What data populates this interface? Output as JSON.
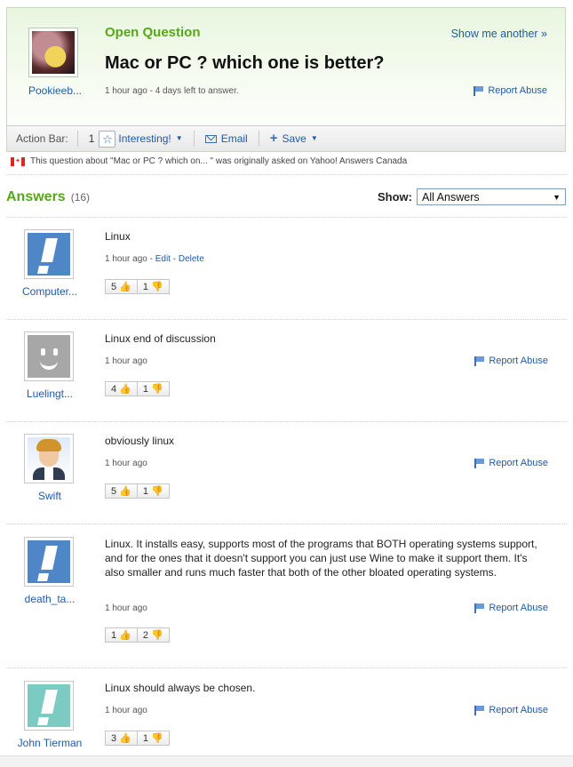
{
  "question": {
    "asker_name": "Pookieeb...",
    "status": "Open Question",
    "title": "Mac or PC ? which one is better?",
    "meta": "1 hour ago - 4 days left to answer.",
    "show_another": "Show me another »",
    "report_abuse": "Report Abuse"
  },
  "action_bar": {
    "label": "Action Bar:",
    "interesting_count": "1",
    "interesting_label": "Interesting!",
    "email_label": "Email",
    "save_label": "Save"
  },
  "origin_note": {
    "text": "This question about \"Mac or PC ? which on... \" was originally asked on Yahoo! Answers Canada"
  },
  "answers_header": {
    "title": "Answers",
    "count": "(16)",
    "show_label": "Show:",
    "show_value": "All Answers"
  },
  "answers": [
    {
      "user": "Computer...",
      "text": "Linux",
      "time": "1 hour ago",
      "edit": "Edit",
      "delete": "Delete",
      "up": "5",
      "down": "1",
      "avatar": "exclamation-blue"
    },
    {
      "user": "Luelingt...",
      "text": "Linux end of discussion",
      "time": "1 hour ago",
      "report": "Report Abuse",
      "up": "4",
      "down": "1",
      "avatar": "smiley-grey"
    },
    {
      "user": "Swift",
      "text": "obviously linux",
      "time": "1 hour ago",
      "report": "Report Abuse",
      "up": "5",
      "down": "1",
      "avatar": "cartoon-person"
    },
    {
      "user": "death_ta...",
      "text": "Linux. It installs easy, supports most of the programs that BOTH operating systems support, and for the ones that it doesn't support you can just use Wine to make it support them. It's also smaller and runs much faster that both of the other bloated operating systems.",
      "time": "1 hour ago",
      "report": "Report Abuse",
      "up": "1",
      "down": "2",
      "avatar": "exclamation-blue"
    },
    {
      "user": "John Tierman",
      "text": "Linux should always be chosen.",
      "time": "1 hour ago",
      "report": "Report Abuse",
      "up": "3",
      "down": "1",
      "avatar": "exclamation-teal"
    }
  ],
  "colors": {
    "accent_green": "#56a817",
    "link_blue": "#1f5aa6"
  }
}
